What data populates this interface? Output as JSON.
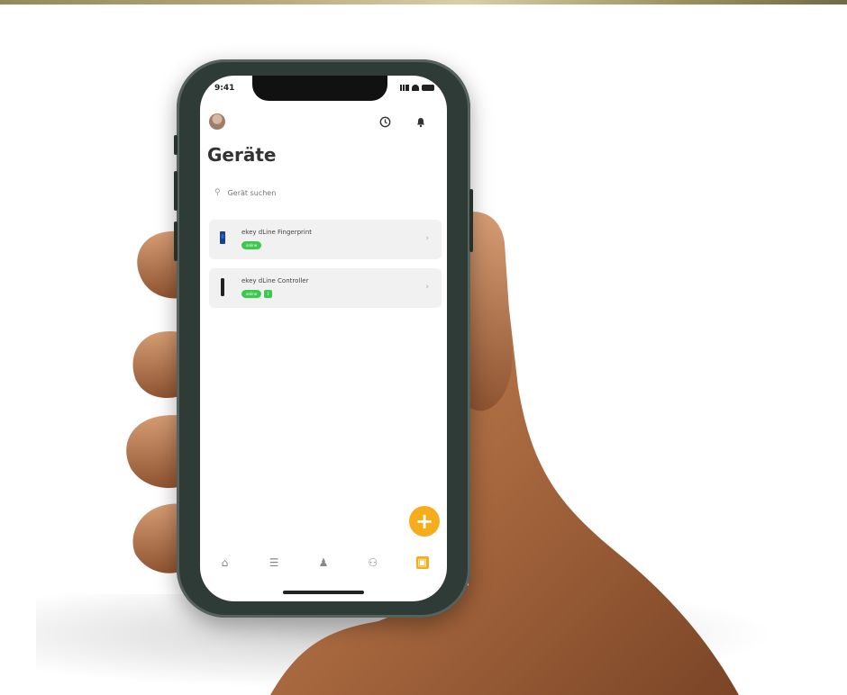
{
  "status_bar": {
    "time": "9:41"
  },
  "header": {
    "title": "Geräte",
    "history_icon": "clock-icon",
    "notification_icon": "bell-icon"
  },
  "search": {
    "placeholder": "Gerät suchen"
  },
  "devices": [
    {
      "name": "ekey dLine Fingerprint",
      "badges": [
        "online"
      ]
    },
    {
      "name": "ekey dLine Controller",
      "badges": [
        "online",
        "1"
      ]
    }
  ],
  "fab": {
    "label": "+"
  },
  "tabbar": {
    "items": [
      {
        "icon": "home-icon",
        "glyph": "⌂"
      },
      {
        "icon": "list-icon",
        "glyph": "☰"
      },
      {
        "icon": "user-icon",
        "glyph": "♟"
      },
      {
        "icon": "users-icon",
        "glyph": "⚇"
      },
      {
        "icon": "devices-icon",
        "glyph": "▣"
      }
    ]
  },
  "colors": {
    "accent": "#f7ad1b",
    "online": "#3ec84f",
    "phone_frame": "#2f3b36"
  }
}
